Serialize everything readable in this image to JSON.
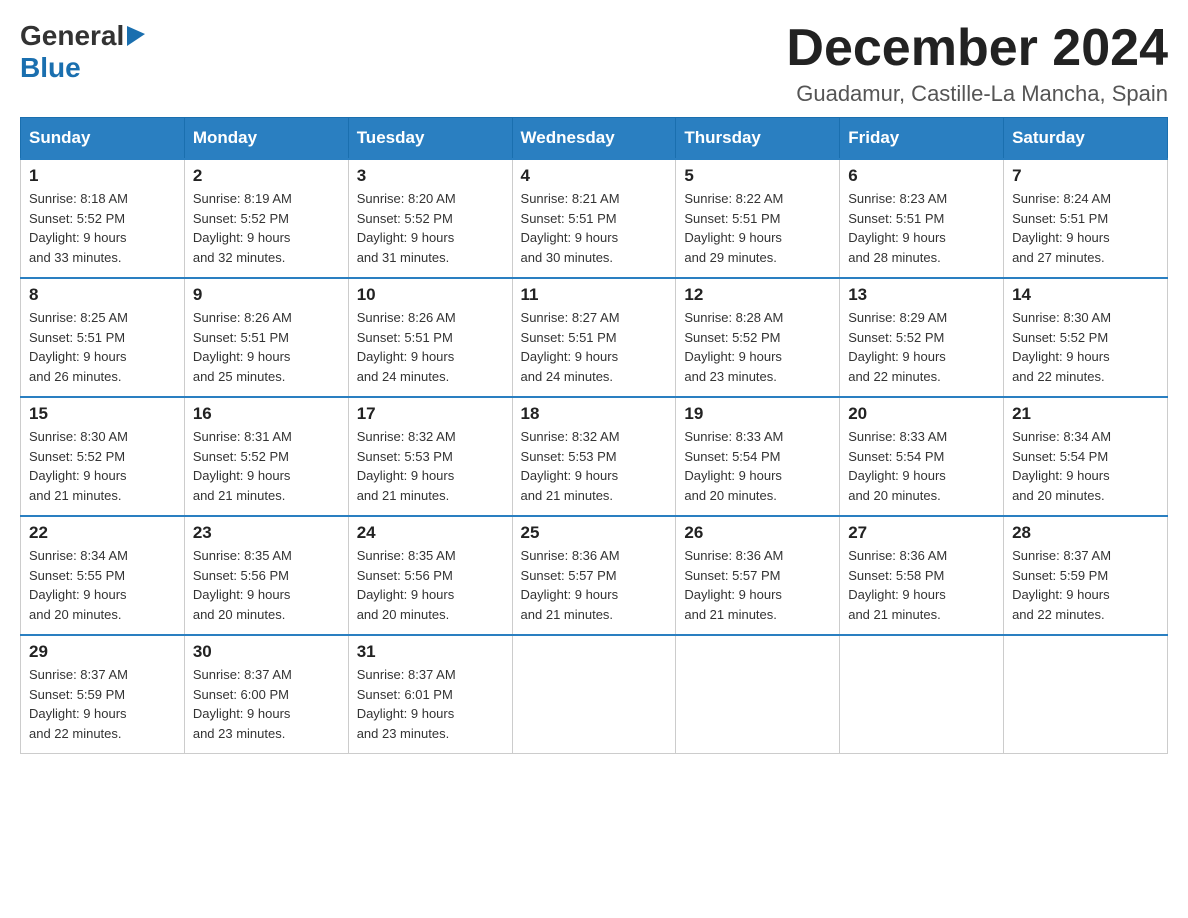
{
  "logo": {
    "general": "General",
    "blue": "Blue"
  },
  "header": {
    "month": "December 2024",
    "location": "Guadamur, Castille-La Mancha, Spain"
  },
  "weekdays": [
    "Sunday",
    "Monday",
    "Tuesday",
    "Wednesday",
    "Thursday",
    "Friday",
    "Saturday"
  ],
  "weeks": [
    [
      {
        "day": "1",
        "sunrise": "8:18 AM",
        "sunset": "5:52 PM",
        "daylight": "9 hours and 33 minutes."
      },
      {
        "day": "2",
        "sunrise": "8:19 AM",
        "sunset": "5:52 PM",
        "daylight": "9 hours and 32 minutes."
      },
      {
        "day": "3",
        "sunrise": "8:20 AM",
        "sunset": "5:52 PM",
        "daylight": "9 hours and 31 minutes."
      },
      {
        "day": "4",
        "sunrise": "8:21 AM",
        "sunset": "5:51 PM",
        "daylight": "9 hours and 30 minutes."
      },
      {
        "day": "5",
        "sunrise": "8:22 AM",
        "sunset": "5:51 PM",
        "daylight": "9 hours and 29 minutes."
      },
      {
        "day": "6",
        "sunrise": "8:23 AM",
        "sunset": "5:51 PM",
        "daylight": "9 hours and 28 minutes."
      },
      {
        "day": "7",
        "sunrise": "8:24 AM",
        "sunset": "5:51 PM",
        "daylight": "9 hours and 27 minutes."
      }
    ],
    [
      {
        "day": "8",
        "sunrise": "8:25 AM",
        "sunset": "5:51 PM",
        "daylight": "9 hours and 26 minutes."
      },
      {
        "day": "9",
        "sunrise": "8:26 AM",
        "sunset": "5:51 PM",
        "daylight": "9 hours and 25 minutes."
      },
      {
        "day": "10",
        "sunrise": "8:26 AM",
        "sunset": "5:51 PM",
        "daylight": "9 hours and 24 minutes."
      },
      {
        "day": "11",
        "sunrise": "8:27 AM",
        "sunset": "5:51 PM",
        "daylight": "9 hours and 24 minutes."
      },
      {
        "day": "12",
        "sunrise": "8:28 AM",
        "sunset": "5:52 PM",
        "daylight": "9 hours and 23 minutes."
      },
      {
        "day": "13",
        "sunrise": "8:29 AM",
        "sunset": "5:52 PM",
        "daylight": "9 hours and 22 minutes."
      },
      {
        "day": "14",
        "sunrise": "8:30 AM",
        "sunset": "5:52 PM",
        "daylight": "9 hours and 22 minutes."
      }
    ],
    [
      {
        "day": "15",
        "sunrise": "8:30 AM",
        "sunset": "5:52 PM",
        "daylight": "9 hours and 21 minutes."
      },
      {
        "day": "16",
        "sunrise": "8:31 AM",
        "sunset": "5:52 PM",
        "daylight": "9 hours and 21 minutes."
      },
      {
        "day": "17",
        "sunrise": "8:32 AM",
        "sunset": "5:53 PM",
        "daylight": "9 hours and 21 minutes."
      },
      {
        "day": "18",
        "sunrise": "8:32 AM",
        "sunset": "5:53 PM",
        "daylight": "9 hours and 21 minutes."
      },
      {
        "day": "19",
        "sunrise": "8:33 AM",
        "sunset": "5:54 PM",
        "daylight": "9 hours and 20 minutes."
      },
      {
        "day": "20",
        "sunrise": "8:33 AM",
        "sunset": "5:54 PM",
        "daylight": "9 hours and 20 minutes."
      },
      {
        "day": "21",
        "sunrise": "8:34 AM",
        "sunset": "5:54 PM",
        "daylight": "9 hours and 20 minutes."
      }
    ],
    [
      {
        "day": "22",
        "sunrise": "8:34 AM",
        "sunset": "5:55 PM",
        "daylight": "9 hours and 20 minutes."
      },
      {
        "day": "23",
        "sunrise": "8:35 AM",
        "sunset": "5:56 PM",
        "daylight": "9 hours and 20 minutes."
      },
      {
        "day": "24",
        "sunrise": "8:35 AM",
        "sunset": "5:56 PM",
        "daylight": "9 hours and 20 minutes."
      },
      {
        "day": "25",
        "sunrise": "8:36 AM",
        "sunset": "5:57 PM",
        "daylight": "9 hours and 21 minutes."
      },
      {
        "day": "26",
        "sunrise": "8:36 AM",
        "sunset": "5:57 PM",
        "daylight": "9 hours and 21 minutes."
      },
      {
        "day": "27",
        "sunrise": "8:36 AM",
        "sunset": "5:58 PM",
        "daylight": "9 hours and 21 minutes."
      },
      {
        "day": "28",
        "sunrise": "8:37 AM",
        "sunset": "5:59 PM",
        "daylight": "9 hours and 22 minutes."
      }
    ],
    [
      {
        "day": "29",
        "sunrise": "8:37 AM",
        "sunset": "5:59 PM",
        "daylight": "9 hours and 22 minutes."
      },
      {
        "day": "30",
        "sunrise": "8:37 AM",
        "sunset": "6:00 PM",
        "daylight": "9 hours and 23 minutes."
      },
      {
        "day": "31",
        "sunrise": "8:37 AM",
        "sunset": "6:01 PM",
        "daylight": "9 hours and 23 minutes."
      },
      null,
      null,
      null,
      null
    ]
  ],
  "labels": {
    "sunrise": "Sunrise:",
    "sunset": "Sunset:",
    "daylight": "Daylight:"
  }
}
